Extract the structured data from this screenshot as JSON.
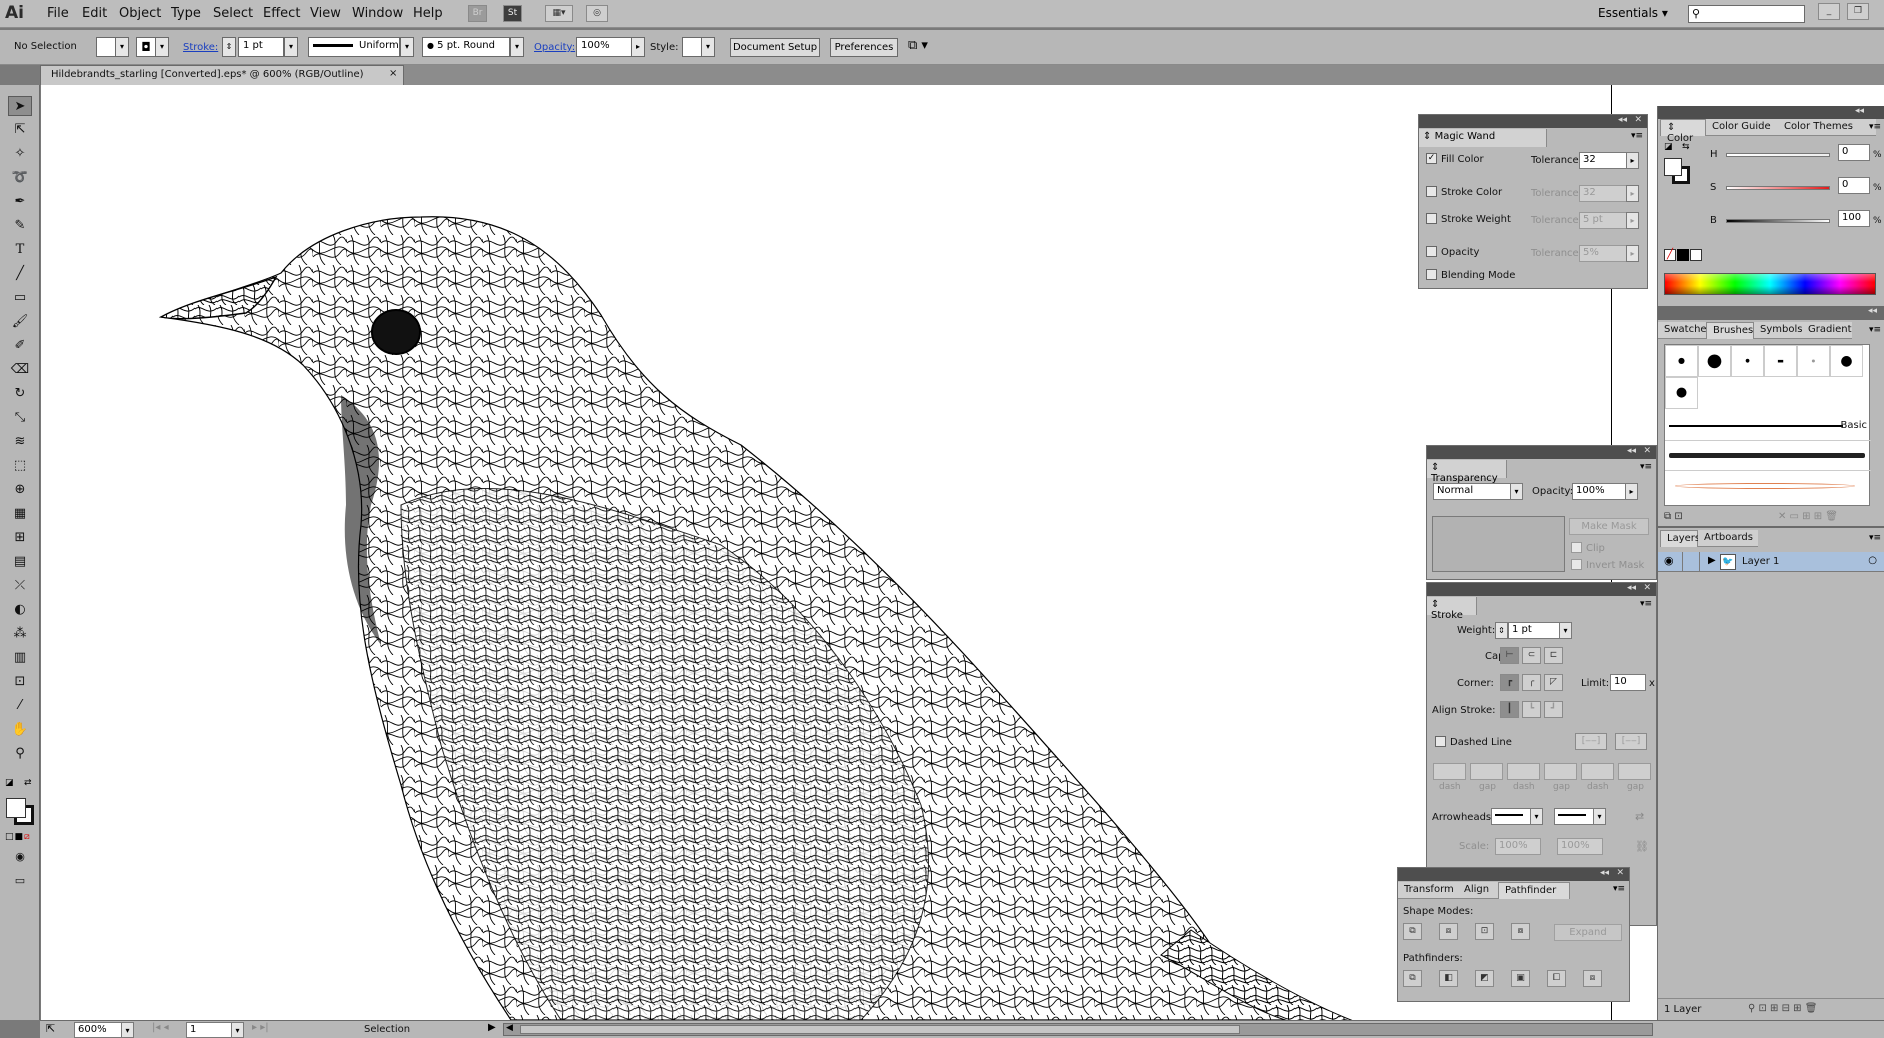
{
  "app": {
    "logo": "Ai",
    "menus": [
      "File",
      "Edit",
      "Object",
      "Type",
      "Select",
      "Effect",
      "View",
      "Window",
      "Help"
    ],
    "bridge": "Br",
    "stock": "St",
    "workspace": "Essentials",
    "search_placeholder": ""
  },
  "control": {
    "selection": "No Selection",
    "stroke_label": "Stroke:",
    "stroke_value": "1 pt",
    "profile": "Uniform",
    "brush": "5 pt. Round",
    "opacity_label": "Opacity:",
    "opacity_value": "100%",
    "style_label": "Style:",
    "doc_setup": "Document Setup",
    "preferences": "Preferences"
  },
  "document": {
    "tab_title": "Hildebrandts_starling [Converted].eps* @ 600% (RGB/Outline)",
    "tab_close": "×"
  },
  "status": {
    "zoom": "600%",
    "artboard": "1",
    "tool": "Selection"
  },
  "magic_wand": {
    "title": "Magic Wand",
    "rows": [
      {
        "label": "Fill Color",
        "checked": true,
        "tol_label": "Tolerance:",
        "tol": "32",
        "enabled": true
      },
      {
        "label": "Stroke Color",
        "checked": false,
        "tol_label": "Tolerance:",
        "tol": "32",
        "enabled": false
      },
      {
        "label": "Stroke Weight",
        "checked": false,
        "tol_label": "Tolerance:",
        "tol": "5 pt",
        "enabled": false
      },
      {
        "label": "Opacity",
        "checked": false,
        "tol_label": "Tolerance:",
        "tol": "5%",
        "enabled": false
      },
      {
        "label": "Blending Mode",
        "checked": false
      }
    ]
  },
  "transparency": {
    "title": "Transparency",
    "mode": "Normal",
    "opacity_label": "Opacity:",
    "opacity": "100%",
    "make_mask": "Make Mask",
    "clip": "Clip",
    "invert_mask": "Invert Mask"
  },
  "stroke": {
    "title": "Stroke",
    "weight_label": "Weight:",
    "weight": "1 pt",
    "cap_label": "Cap:",
    "corner_label": "Corner:",
    "limit_label": "Limit:",
    "limit": "10",
    "limit_unit": "x",
    "align_label": "Align Stroke:",
    "dashed_label": "Dashed Line",
    "dash_labels": [
      "dash",
      "gap",
      "dash",
      "gap",
      "dash",
      "gap"
    ],
    "arrowheads_label": "Arrowheads:",
    "scale_label": "Scale:",
    "scale1": "100%",
    "scale2": "100%"
  },
  "pathfinder": {
    "tabs": [
      "Transform",
      "Align",
      "Pathfinder"
    ],
    "active": "Pathfinder",
    "shape_modes_label": "Shape Modes:",
    "expand": "Expand",
    "pathfinders_label": "Pathfinders:"
  },
  "color": {
    "tabs": [
      "Color",
      "Color Guide",
      "Color Themes"
    ],
    "active": "Color",
    "h_label": "H",
    "h": "0",
    "s_label": "S",
    "s": "0",
    "b_label": "B",
    "b": "100",
    "unit": "%"
  },
  "brushes": {
    "tabs": [
      "Swatches",
      "Brushes",
      "Symbols",
      "Gradient"
    ],
    "active": "Brushes",
    "basic_label": "Basic"
  },
  "layers": {
    "tabs": [
      "Layers",
      "Artboards"
    ],
    "active": "Layers",
    "layer_name": "Layer 1",
    "count": "1 Layer"
  },
  "colors": {
    "ui_bg": "#b9b9b9",
    "panel_header": "#4e4e4e",
    "layer_highlight": "#a9c0dc",
    "link_blue": "#1a3fc0"
  }
}
